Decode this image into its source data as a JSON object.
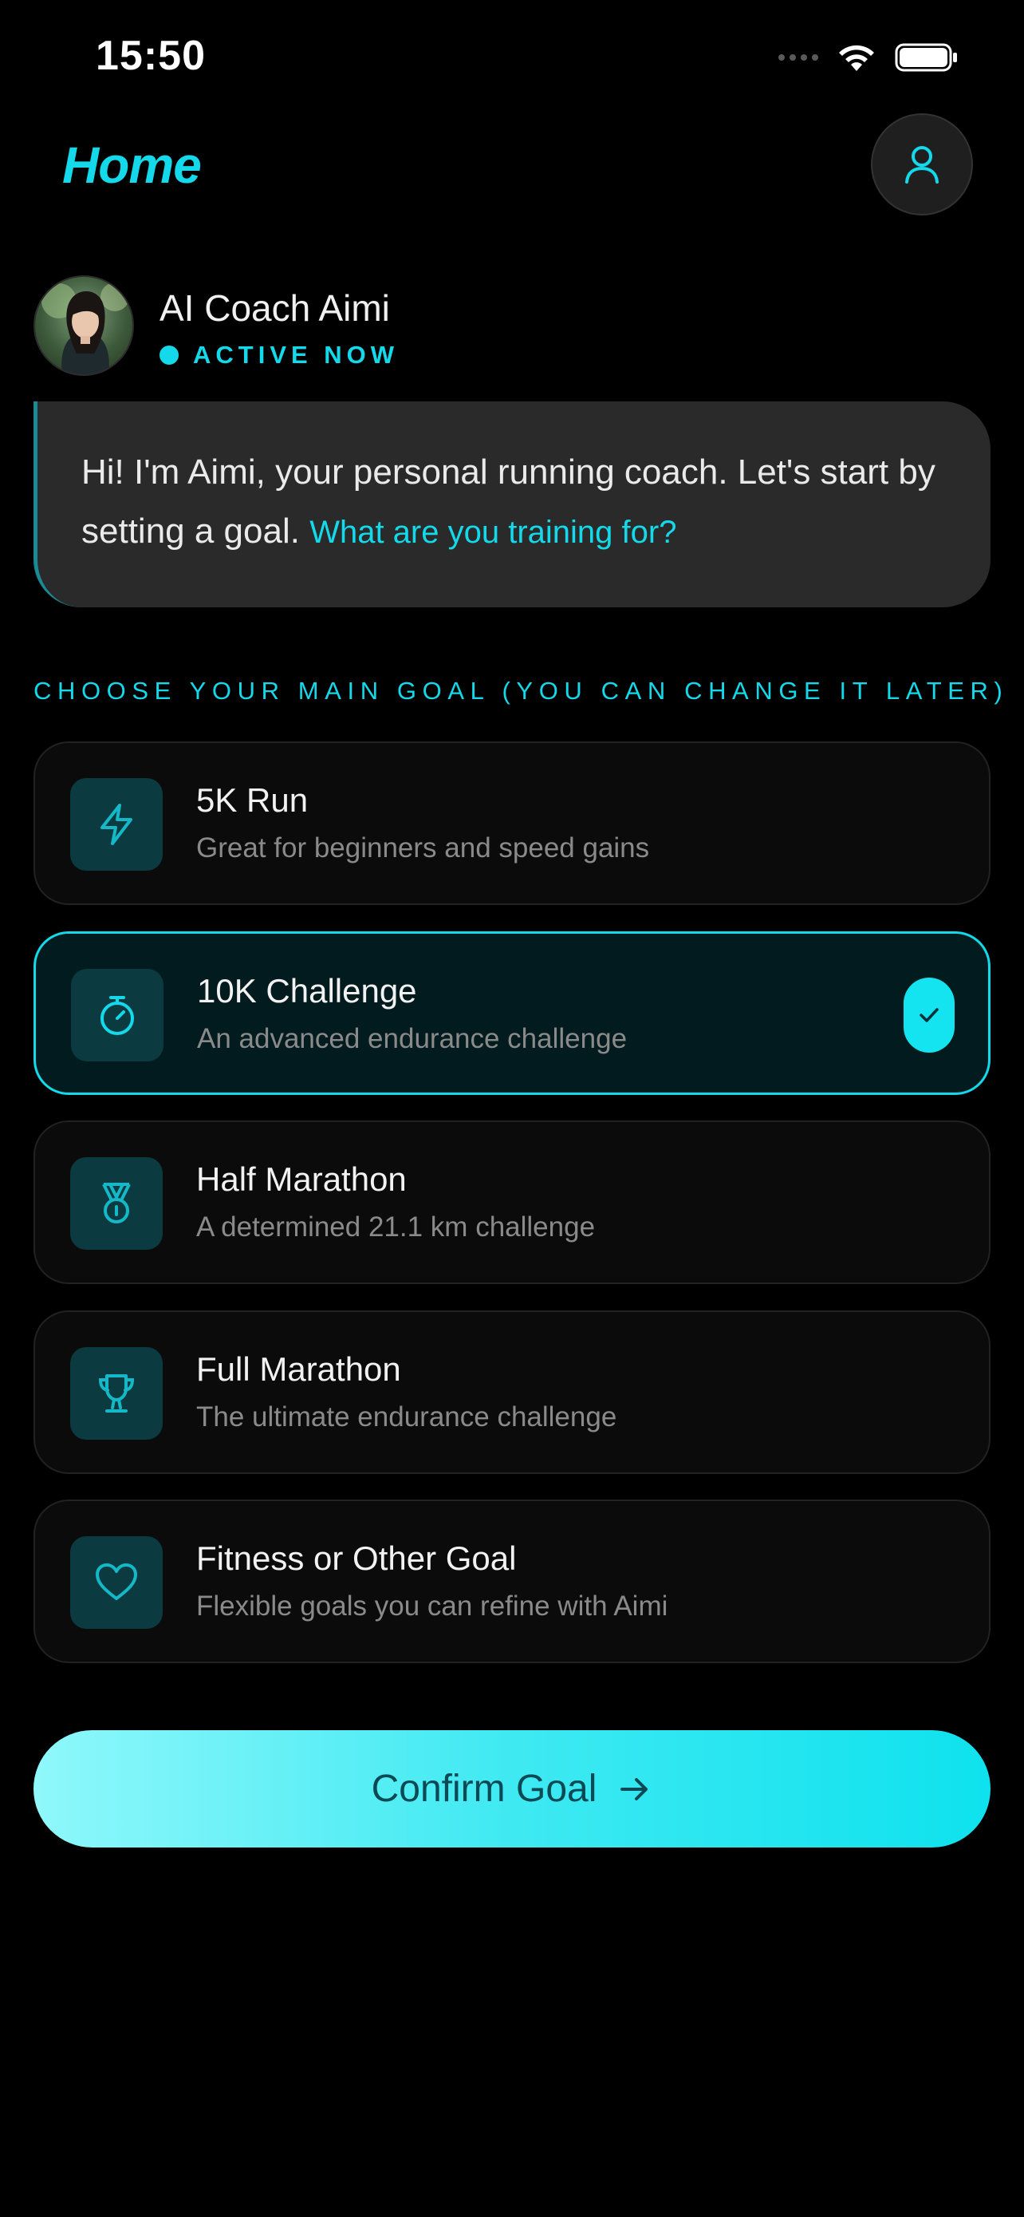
{
  "status_bar": {
    "time": "15:50"
  },
  "header": {
    "title": "Home",
    "profile_icon": "user-icon"
  },
  "coach": {
    "name": "AI Coach Aimi",
    "status": "ACTIVE NOW",
    "message": "Hi! I'm Aimi, your personal running coach. Let's start by setting a goal.",
    "message_highlight": "What are you training for?"
  },
  "goals_section": {
    "label": "CHOOSE YOUR MAIN GOAL (YOU CAN CHANGE IT LATER)",
    "items": [
      {
        "title": "5K Run",
        "description": "Great for beginners and speed gains",
        "icon": "lightning-icon",
        "selected": false
      },
      {
        "title": "10K Challenge",
        "description": "An advanced endurance challenge",
        "icon": "stopwatch-icon",
        "selected": true
      },
      {
        "title": "Half Marathon",
        "description": "A determined 21.1 km challenge",
        "icon": "medal-icon",
        "selected": false
      },
      {
        "title": "Full Marathon",
        "description": "The ultimate endurance challenge",
        "icon": "trophy-icon",
        "selected": false
      },
      {
        "title": "Fitness or Other Goal",
        "description": "Flexible goals you can refine with Aimi",
        "icon": "heart-icon",
        "selected": false
      }
    ]
  },
  "confirm_button": {
    "label": "Confirm Goal",
    "icon": "arrow-right-icon"
  },
  "colors": {
    "accent": "#14d9ea",
    "background": "#000000",
    "card": "#0b0b0b",
    "selected_card": "#021b1e",
    "bubble": "#2a2a2a"
  }
}
